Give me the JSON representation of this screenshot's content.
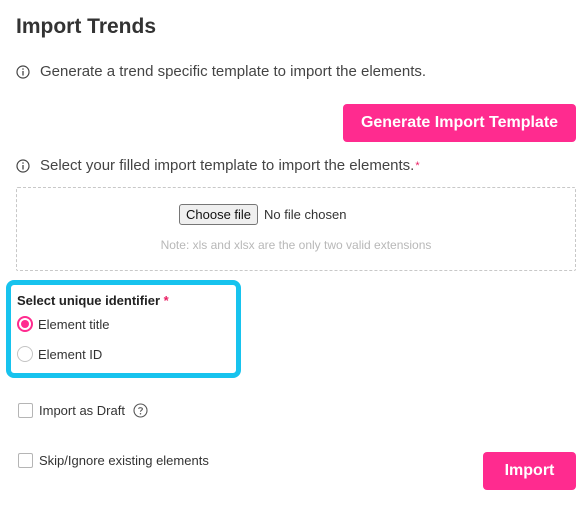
{
  "page": {
    "title": "Import Trends"
  },
  "generate_section": {
    "info_text": "Generate a trend specific template to import the elements.",
    "info_icon": "info-circle-icon",
    "button_label": "Generate Import Template"
  },
  "upload_section": {
    "info_text": "Select your filled import template to import the elements.",
    "required_marker": "*",
    "choose_file_label": "Choose file",
    "file_status": "No file chosen",
    "note": "Note: xls and xlsx are the only two valid extensions"
  },
  "identifier": {
    "label": "Select unique identifier",
    "required_marker": "*",
    "options": [
      {
        "label": "Element title",
        "selected": true
      },
      {
        "label": "Element ID",
        "selected": false
      }
    ],
    "highlight_color": "#17c3ee"
  },
  "options": {
    "import_as_draft": {
      "label": "Import as Draft",
      "checked": false,
      "help_icon": "question-circle-icon"
    },
    "skip_existing": {
      "label": "Skip/Ignore existing elements",
      "checked": false
    }
  },
  "actions": {
    "import_label": "Import"
  },
  "colors": {
    "accent": "#ff2b8f",
    "required": "#e91e63"
  }
}
